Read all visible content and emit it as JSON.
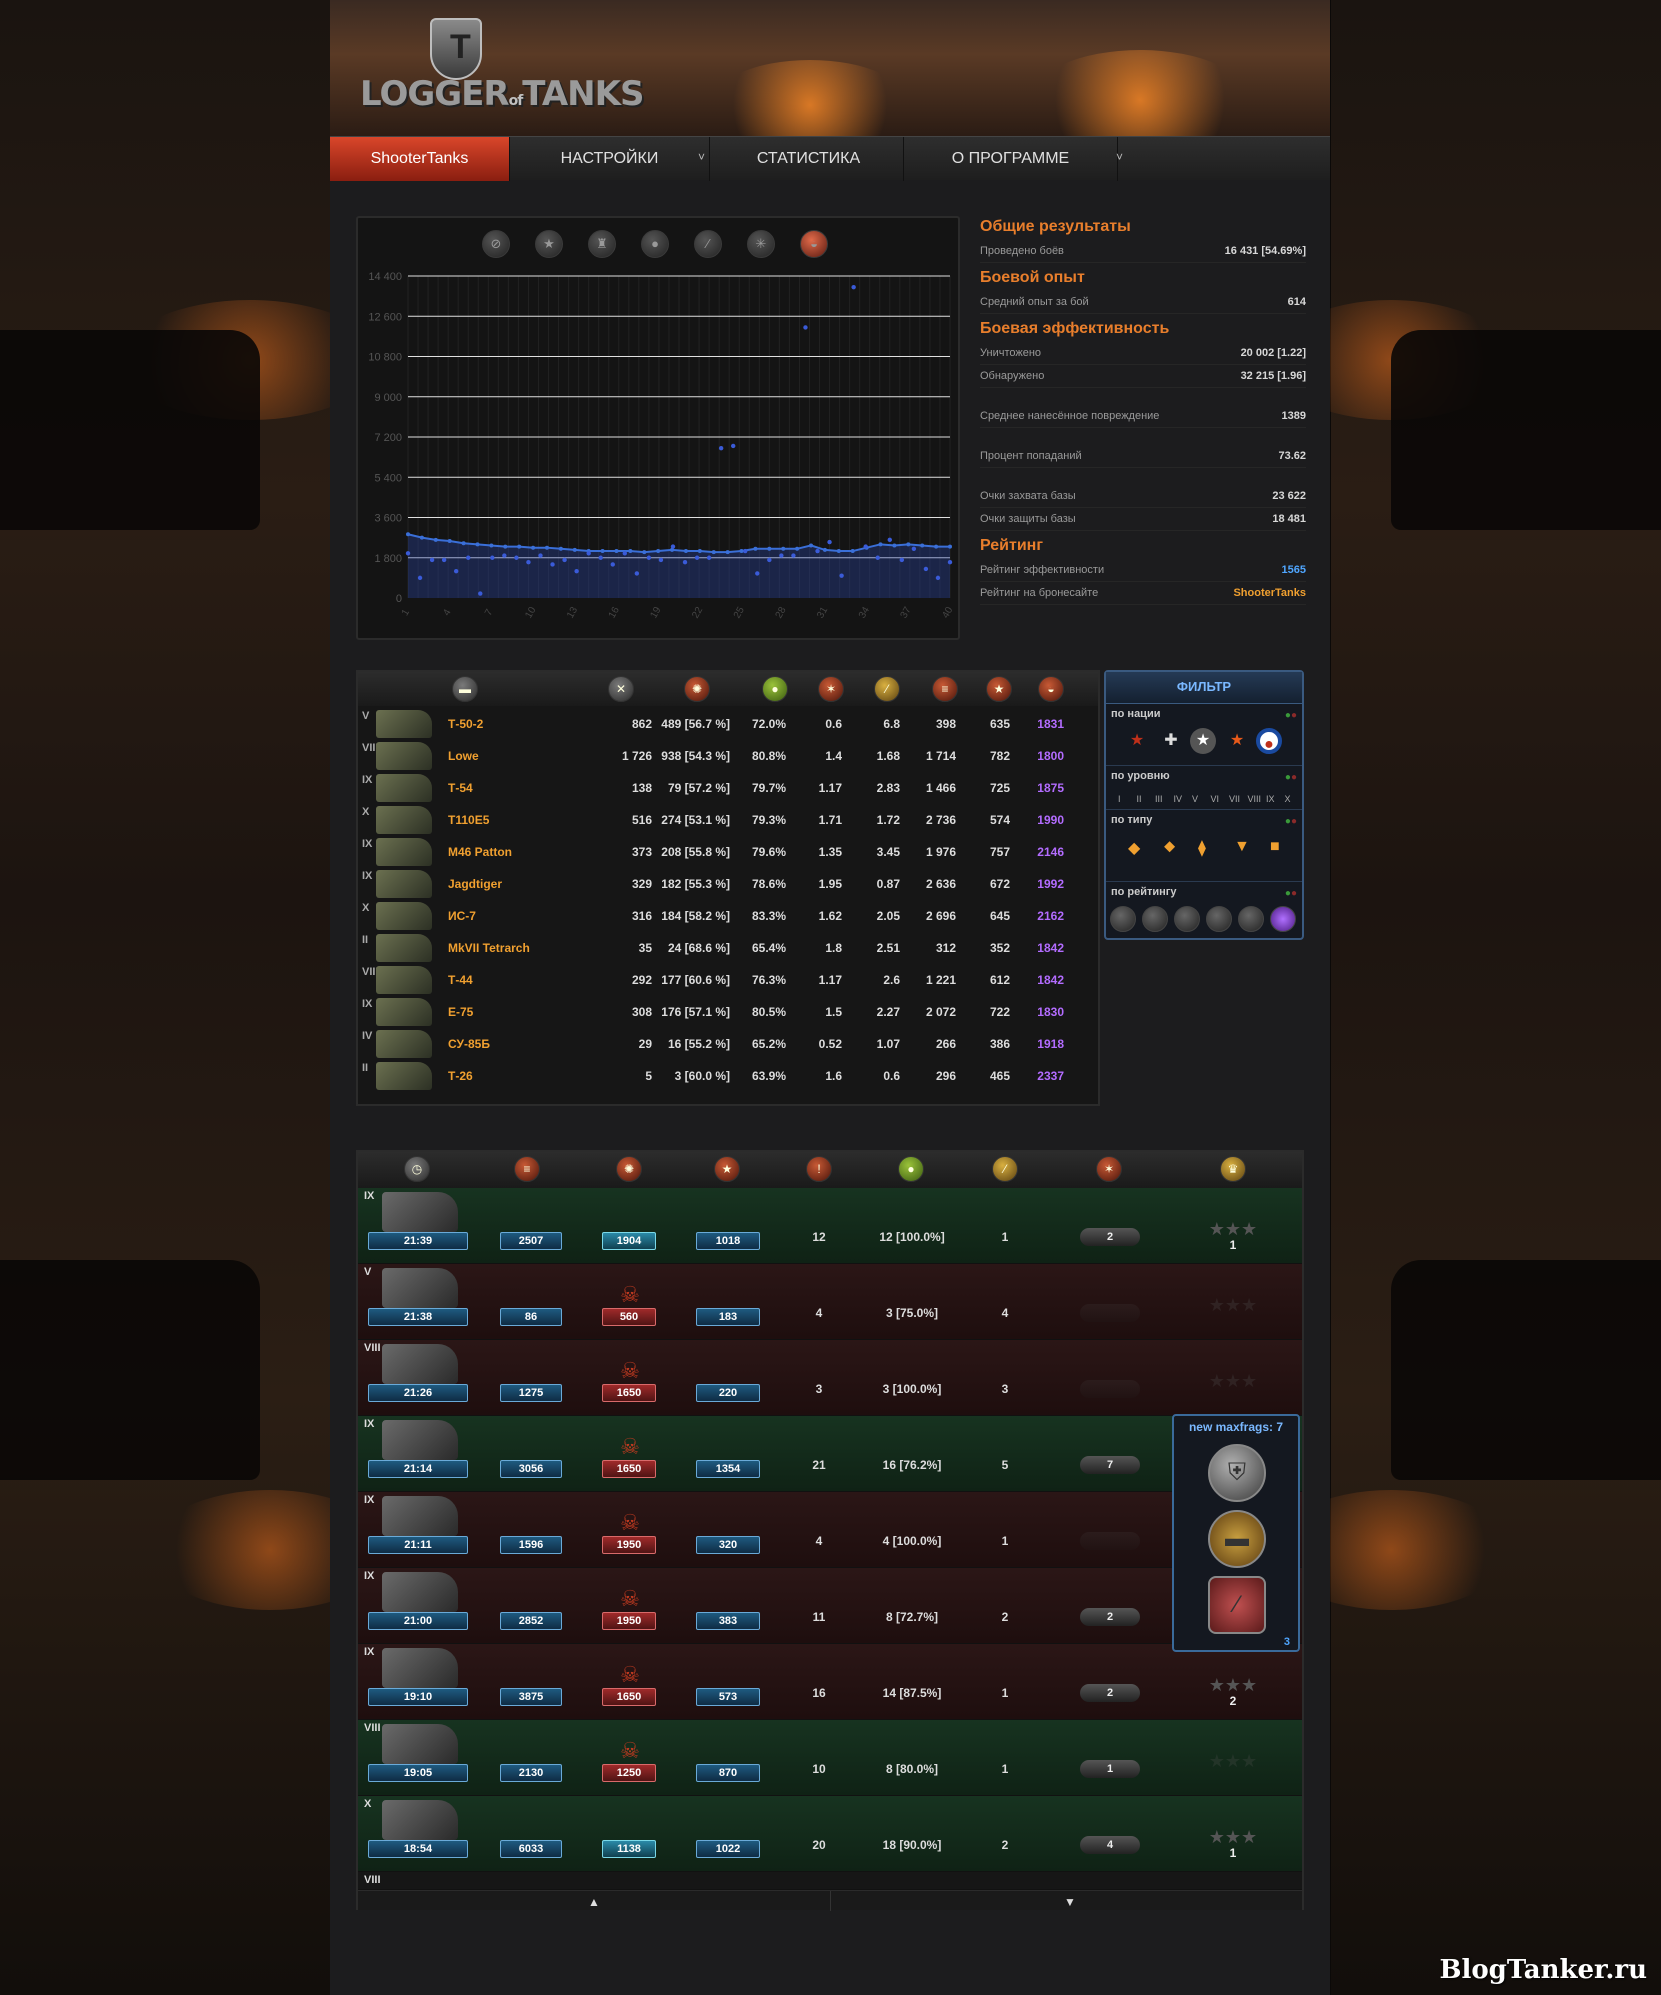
{
  "brand": {
    "logo_text": "LOGGER",
    "logo_of": "of",
    "logo_text2": "TANKS",
    "emblem": "T"
  },
  "nav": {
    "items": [
      {
        "label": "ShooterTanks",
        "active": true
      },
      {
        "label": "НАСТРОЙКИ",
        "has_dropdown": true
      },
      {
        "label": "СТАТИСТИКА"
      },
      {
        "label": "О ПРОГРАММЕ",
        "has_dropdown": true
      }
    ]
  },
  "graph": {
    "icons": [
      "battles-icon",
      "wins-icon",
      "frags-icon",
      "survival-icon",
      "shots-icon",
      "damage-icon",
      "rating-icon"
    ],
    "selected_icon": "rating-icon"
  },
  "chart_data": {
    "type": "scatter",
    "x": [
      1,
      2,
      3,
      4,
      5,
      6,
      7,
      8,
      9,
      10,
      11,
      12,
      13,
      14,
      15,
      16,
      17,
      18,
      19,
      20,
      21,
      22,
      23,
      24,
      25,
      26,
      27,
      28,
      29,
      30,
      31,
      32,
      33,
      34,
      35,
      36,
      37,
      38,
      39,
      40
    ],
    "points": [
      2000,
      900,
      1700,
      1700,
      1200,
      1800,
      200,
      1800,
      1900,
      1800,
      1600,
      1900,
      1500,
      1700,
      1200,
      2000,
      1800,
      1500,
      2000,
      1100,
      1800,
      1700,
      2300,
      1600,
      1800,
      1800,
      6700,
      6800,
      2100,
      1100,
      1700,
      1900,
      1900,
      12100,
      2100,
      2500,
      1000,
      13900,
      2300,
      1800,
      2600,
      1700,
      2200,
      1300,
      900,
      1600
    ],
    "series": [
      {
        "name": "",
        "values": [
          2850,
          2700,
          2600,
          2550,
          2450,
          2400,
          2350,
          2300,
          2300,
          2250,
          2250,
          2200,
          2150,
          2100,
          2100,
          2100,
          2100,
          2050,
          2100,
          2150,
          2100,
          2100,
          2050,
          2050,
          2100,
          2200,
          2200,
          2200,
          2200,
          2350,
          2150,
          2100,
          2100,
          2250,
          2400,
          2350,
          2400,
          2350,
          2300,
          2300
        ]
      }
    ],
    "xticks": [
      "1",
      "4",
      "7",
      "10",
      "13",
      "16",
      "19",
      "22",
      "25",
      "28",
      "31",
      "34",
      "37",
      "40"
    ],
    "yticks": [
      "0",
      "1 800",
      "3 600",
      "5 400",
      "7 200",
      "9 000",
      "10 800",
      "12 600",
      "14 400"
    ],
    "ylim": [
      0,
      14400
    ],
    "xlim": [
      1,
      40
    ],
    "grid": true,
    "point_color": "#3a5bd8",
    "line_color": "#3a6fd8"
  },
  "stats": {
    "sections": [
      {
        "title": "Общие результаты",
        "rows": [
          {
            "label": "Проведено боёв",
            "value": "16 431 [54.69%]"
          }
        ]
      },
      {
        "title": "Боевой опыт",
        "rows": [
          {
            "label": "Средний опыт за бой",
            "value": "614"
          }
        ]
      },
      {
        "title": "Боевая эффективность",
        "rows": [
          {
            "label": "Уничтожено",
            "value": "20 002 [1.22]"
          },
          {
            "label": "Обнаружено",
            "value": "32 215 [1.96]"
          },
          {
            "label": "",
            "value": ""
          },
          {
            "label": "Среднее нанесённое повреждение",
            "value": "1389"
          },
          {
            "label": "",
            "value": ""
          },
          {
            "label": "Процент попаданий",
            "value": "73.62"
          },
          {
            "label": "",
            "value": ""
          },
          {
            "label": "Очки захвата базы",
            "value": "23 622"
          },
          {
            "label": "Очки защиты базы",
            "value": "18 481"
          }
        ]
      },
      {
        "title": "Рейтинг",
        "rows": [
          {
            "label": "Рейтинг эффективности",
            "value": "1565",
            "color": "blue"
          },
          {
            "label": "Рейтинг на бронесайте",
            "value": "ShooterTanks",
            "color": "orange"
          }
        ]
      }
    ]
  },
  "tanks": {
    "header_icons": [
      "tank-icon",
      "battles-icon",
      "wins-icon",
      "survival-icon",
      "frags-icon",
      "shots-icon",
      "damage-icon",
      "rating-star-icon",
      "efficiency-icon"
    ],
    "rows": [
      {
        "tier": "V",
        "name": "Т-50-2",
        "battles": "862",
        "wins": "489 [56.7 %]",
        "surv": "72.0%",
        "frags": "0.6",
        "spot": "6.8",
        "dmg": "398",
        "xp": "635",
        "eff": "1831"
      },
      {
        "tier": "VIII",
        "name": "Lowe",
        "battles": "1 726",
        "wins": "938 [54.3 %]",
        "surv": "80.8%",
        "frags": "1.4",
        "spot": "1.68",
        "dmg": "1 714",
        "xp": "782",
        "eff": "1800"
      },
      {
        "tier": "IX",
        "name": "Т-54",
        "battles": "138",
        "wins": "79 [57.2 %]",
        "surv": "79.7%",
        "frags": "1.17",
        "spot": "2.83",
        "dmg": "1 466",
        "xp": "725",
        "eff": "1875"
      },
      {
        "tier": "X",
        "name": "T110E5",
        "battles": "516",
        "wins": "274 [53.1 %]",
        "surv": "79.3%",
        "frags": "1.71",
        "spot": "1.72",
        "dmg": "2 736",
        "xp": "574",
        "eff": "1990"
      },
      {
        "tier": "IX",
        "name": "M46 Patton",
        "battles": "373",
        "wins": "208 [55.8 %]",
        "surv": "79.6%",
        "frags": "1.35",
        "spot": "3.45",
        "dmg": "1 976",
        "xp": "757",
        "eff": "2146"
      },
      {
        "tier": "IX",
        "name": "Jagdtiger",
        "battles": "329",
        "wins": "182 [55.3 %]",
        "surv": "78.6%",
        "frags": "1.95",
        "spot": "0.87",
        "dmg": "2 636",
        "xp": "672",
        "eff": "1992"
      },
      {
        "tier": "X",
        "name": "ИС-7",
        "battles": "316",
        "wins": "184 [58.2 %]",
        "surv": "83.3%",
        "frags": "1.62",
        "spot": "2.05",
        "dmg": "2 696",
        "xp": "645",
        "eff": "2162"
      },
      {
        "tier": "II",
        "name": "MkVII Tetrarch",
        "battles": "35",
        "wins": "24 [68.6 %]",
        "surv": "65.4%",
        "frags": "1.8",
        "spot": "2.51",
        "dmg": "312",
        "xp": "352",
        "eff": "1842"
      },
      {
        "tier": "VIII",
        "name": "Т-44",
        "battles": "292",
        "wins": "177 [60.6 %]",
        "surv": "76.3%",
        "frags": "1.17",
        "spot": "2.6",
        "dmg": "1 221",
        "xp": "612",
        "eff": "1842"
      },
      {
        "tier": "IX",
        "name": "E-75",
        "battles": "308",
        "wins": "176 [57.1 %]",
        "surv": "80.5%",
        "frags": "1.5",
        "spot": "2.27",
        "dmg": "2 072",
        "xp": "722",
        "eff": "1830"
      },
      {
        "tier": "IV",
        "name": "СУ-85Б",
        "battles": "29",
        "wins": "16 [55.2 %]",
        "surv": "65.2%",
        "frags": "0.52",
        "spot": "1.07",
        "dmg": "266",
        "xp": "386",
        "eff": "1918"
      },
      {
        "tier": "II",
        "name": "Т-26",
        "battles": "5",
        "wins": "3 [60.0 %]",
        "surv": "63.9%",
        "frags": "1.6",
        "spot": "0.6",
        "dmg": "296",
        "xp": "465",
        "eff": "2337"
      }
    ]
  },
  "filter": {
    "title": "ФИЛЬТР",
    "by_nation": "по нации",
    "by_level": "по уровню",
    "by_type": "по типу",
    "by_rating": "по рейтингу",
    "levels": [
      "I",
      "II",
      "III",
      "IV",
      "V",
      "VI",
      "VII",
      "VIII",
      "IX",
      "X"
    ]
  },
  "battles": {
    "header_icons": [
      "time-icon",
      "damage-icon",
      "xp-icon",
      "rating-star-icon",
      "shots-icon",
      "hits-icon",
      "frags-icon",
      "spotted-icon",
      "medals-icon"
    ],
    "rows": [
      {
        "tier": "IX",
        "result": "win",
        "time": "21:39",
        "dmg": "2507",
        "xp": "1904",
        "xp_red": false,
        "xp_cy": true,
        "skull": false,
        "credits": "1018",
        "shots": "12",
        "hits": "12 [100.0%]",
        "frags": "1",
        "mark": "2",
        "stars": "1"
      },
      {
        "tier": "V",
        "result": "lose",
        "time": "21:38",
        "dmg": "86",
        "xp": "560",
        "xp_red": true,
        "skull": true,
        "credits": "183",
        "shots": "4",
        "hits": "3 [75.0%]",
        "frags": "4",
        "mark": "",
        "stars": ""
      },
      {
        "tier": "VIII",
        "result": "lose",
        "time": "21:26",
        "dmg": "1275",
        "xp": "1650",
        "xp_red": true,
        "skull": true,
        "credits": "220",
        "shots": "3",
        "hits": "3 [100.0%]",
        "frags": "3",
        "mark": "",
        "stars": ""
      },
      {
        "tier": "IX",
        "result": "win",
        "time": "21:14",
        "dmg": "3056",
        "xp": "1650",
        "xp_red": true,
        "skull": true,
        "credits": "1354",
        "shots": "21",
        "hits": "16 [76.2%]",
        "frags": "5",
        "mark": "7",
        "stars": ""
      },
      {
        "tier": "IX",
        "result": "lose",
        "time": "21:11",
        "dmg": "1596",
        "xp": "1950",
        "xp_red": true,
        "skull": true,
        "credits": "320",
        "shots": "4",
        "hits": "4 [100.0%]",
        "frags": "1",
        "mark": "",
        "stars": ""
      },
      {
        "tier": "IX",
        "result": "lose",
        "time": "21:00",
        "dmg": "2852",
        "xp": "1950",
        "xp_red": true,
        "skull": true,
        "credits": "383",
        "shots": "11",
        "hits": "8 [72.7%]",
        "frags": "2",
        "mark": "2",
        "stars": ""
      },
      {
        "tier": "IX",
        "result": "lose",
        "time": "19:10",
        "dmg": "3875",
        "xp": "1650",
        "xp_red": true,
        "skull": true,
        "credits": "573",
        "shots": "16",
        "hits": "14 [87.5%]",
        "frags": "1",
        "mark": "2",
        "stars": "2"
      },
      {
        "tier": "VIII",
        "result": "win",
        "time": "19:05",
        "dmg": "2130",
        "xp": "1250",
        "xp_red": true,
        "skull": true,
        "credits": "870",
        "shots": "10",
        "hits": "8 [80.0%]",
        "frags": "1",
        "mark": "1",
        "stars": ""
      },
      {
        "tier": "X",
        "result": "win",
        "time": "18:54",
        "dmg": "6033",
        "xp": "1138",
        "xp_red": false,
        "xp_cy": true,
        "skull": false,
        "credits": "1022",
        "shots": "20",
        "hits": "18 [90.0%]",
        "frags": "2",
        "mark": "4",
        "stars": "1"
      }
    ],
    "last_tier": "VIII"
  },
  "popup": {
    "title": "new maxfrags: 7",
    "count": "3"
  },
  "watermark": "BlogTanker.ru"
}
